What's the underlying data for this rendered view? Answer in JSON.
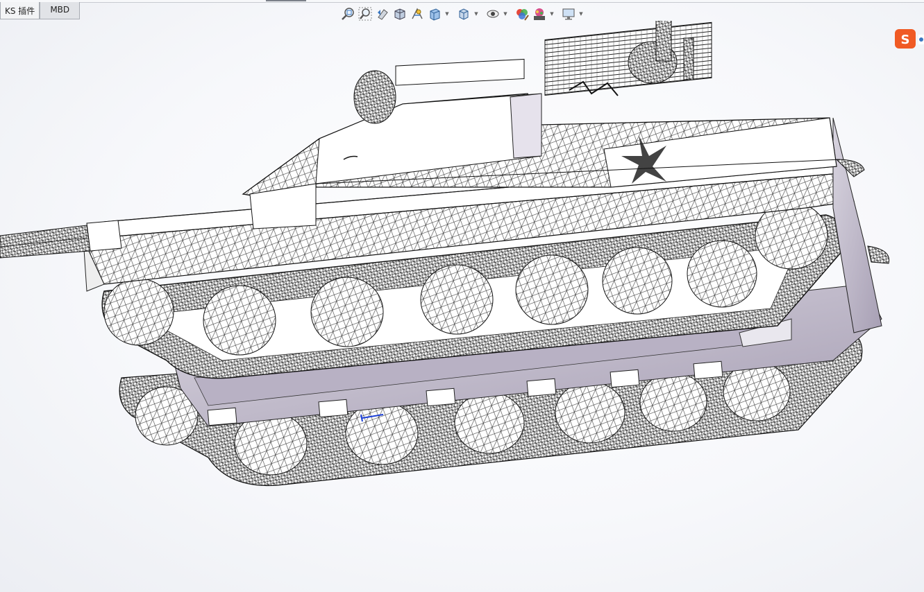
{
  "tabs": [
    {
      "label": "KS 插件",
      "active": false
    },
    {
      "label": "MBD",
      "active": true
    }
  ],
  "toolbar": {
    "icons": [
      "zoom-to-fit-icon",
      "zoom-to-area-icon",
      "previous-view-icon",
      "section-view-icon",
      "dynamic-annotation-icon",
      "view-orientation-icon",
      "display-style-icon",
      "hide-show-items-icon",
      "edit-appearance-icon",
      "apply-scene-icon",
      "view-settings-icon"
    ]
  },
  "ime": {
    "icon": "sogou-ime-icon",
    "glyph": "S"
  },
  "model": {
    "description_icon": "tank-wireframe-model",
    "colors": {
      "shade": "#c9c4d3",
      "edge": "#1a1a1a",
      "face": "#ffffff"
    }
  }
}
